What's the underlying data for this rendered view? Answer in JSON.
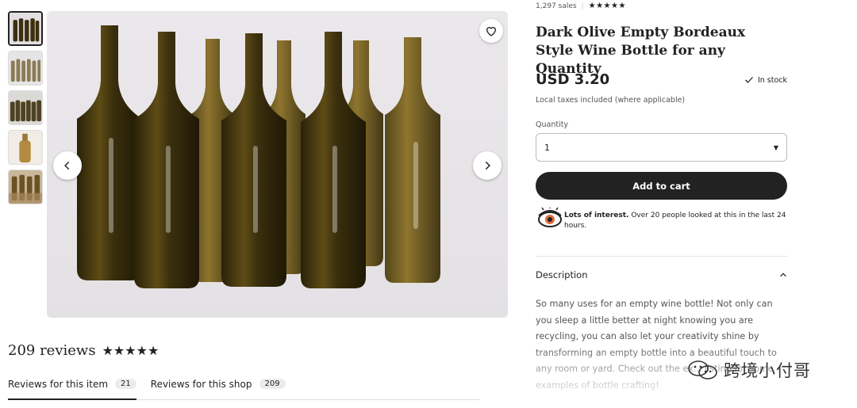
{
  "gallery": {
    "thumbnails": [
      {
        "name": "thumb-bottles-front",
        "active": true
      },
      {
        "name": "thumb-bottles-group",
        "active": false
      },
      {
        "name": "thumb-bottles-row",
        "active": false
      },
      {
        "name": "thumb-bottle-single",
        "active": false
      },
      {
        "name": "thumb-bottles-case",
        "active": false
      }
    ],
    "favorite_icon": "heart-icon",
    "prev_icon": "chevron-left-icon",
    "next_icon": "chevron-right-icon"
  },
  "reviews": {
    "count_label": "209 reviews",
    "stars": "★★★★★",
    "tabs": [
      {
        "label": "Reviews for this item",
        "count": "21",
        "active": true
      },
      {
        "label": "Reviews for this shop",
        "count": "209",
        "active": false
      }
    ]
  },
  "listing": {
    "sales": "1,297 sales",
    "sales_stars": "★★★★★",
    "title": "Dark Olive Empty Bordeaux Style Wine Bottle for any Quantity",
    "price": "USD 3.20",
    "stock": "In stock",
    "taxes": "Local taxes included (where applicable)",
    "quantity_label": "Quantity",
    "quantity_value": "1",
    "add_to_cart": "Add to cart",
    "interest_bold": "Lots of interest.",
    "interest_text": " Over 20 people looked at this in the last 24 hours.",
    "description_label": "Description",
    "description_text": "So many uses for an empty wine bottle! Not only can you sleep a little better at night knowing you are recycling, you can also let your creativity shine by transforming an empty bottle into a beautiful touch to any room or yard. Check out the ex... listing for some examples of bottle crafting!"
  },
  "watermark": {
    "text": "跨境小付哥"
  },
  "colors": {
    "primary": "#222222",
    "muted": "#555555",
    "bottle": "#3a2e0c",
    "background_photo": "#e9e6ea"
  }
}
